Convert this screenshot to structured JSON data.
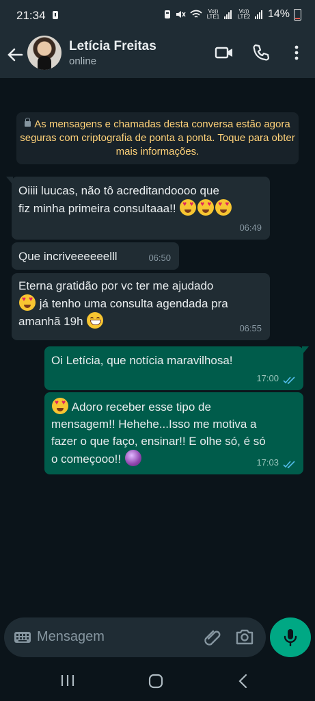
{
  "status_bar": {
    "time": "21:34",
    "sim1": "Vo)) LTE1",
    "sim2": "Vo)) LTE2",
    "battery": "14%"
  },
  "header": {
    "contact_name": "Letícia Freitas",
    "status": "online",
    "icons": [
      "back-arrow-icon",
      "video-call-icon",
      "phone-icon",
      "more-options-icon"
    ]
  },
  "chat": {
    "encryption_notice": "As mensagens e chamadas desta conversa estão agora seguras com criptografia de ponta a ponta. Toque para obter mais informações.",
    "messages": [
      {
        "direction": "incoming",
        "line1": "Oiiii luucas, não tô acreditandoooo que",
        "line2": "fiz minha primeira consultaaa!!",
        "emoji": "😍😍😍",
        "time": "06:49"
      },
      {
        "direction": "incoming",
        "text": "Que incriveeeeeelll",
        "time": "06:50"
      },
      {
        "direction": "incoming",
        "line1": "Eterna gratidão por vc ter me ajudado",
        "line2": "já tenho uma consulta agendada pra",
        "line3": "amanhã 19h",
        "emoji1": "😍",
        "emoji2": "😁",
        "time": "06:55"
      },
      {
        "direction": "outgoing",
        "text": "Oi Letícia, que notícia maravilhosa!",
        "time": "17:00",
        "read": true
      },
      {
        "direction": "outgoing",
        "line1": "Adoro receber esse tipo de",
        "line2": "mensagem!! Hehehe...Isso me motiva a",
        "line3": "fazer o que faço, ensinar!! E olhe só, é só",
        "line4": "o começooo!!",
        "emoji1": "😍",
        "emoji2": "🔮",
        "time": "17:03",
        "read": true
      }
    ]
  },
  "input": {
    "placeholder": "Mensagem",
    "icons": [
      "keyboard-icon",
      "attach-icon",
      "camera-icon",
      "mic-icon"
    ]
  },
  "colors": {
    "background": "#0b141a",
    "header": "#1f2c34",
    "incoming_bubble": "#202c33",
    "outgoing_bubble": "#005c4b",
    "accent": "#00a884",
    "notice_text": "#ffd279",
    "read_ticks": "#53bdeb"
  }
}
